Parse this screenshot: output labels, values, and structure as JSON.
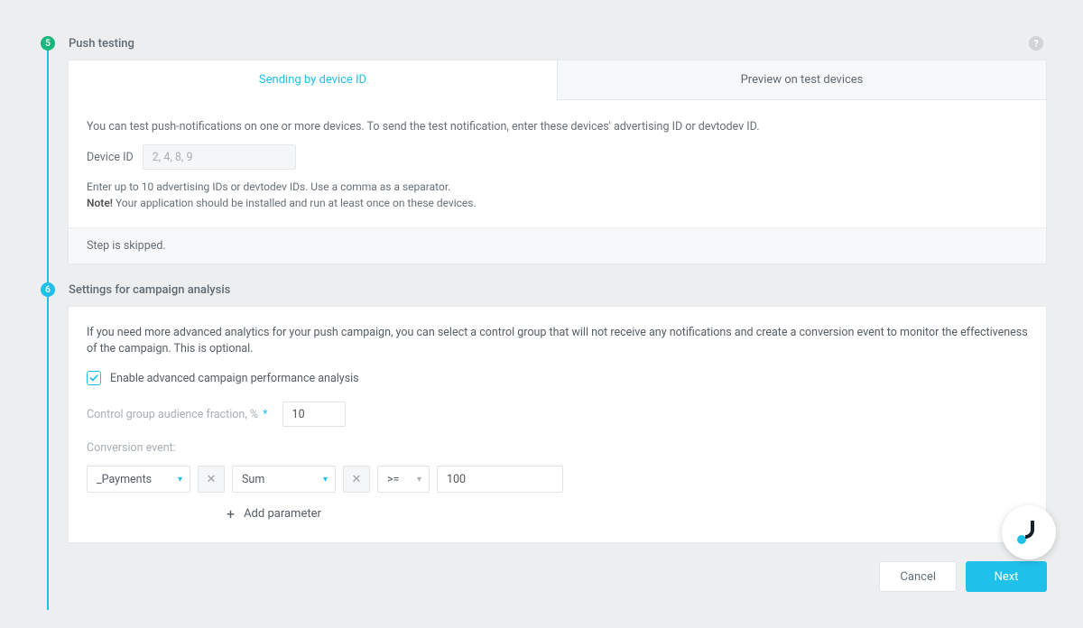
{
  "step5": {
    "number": "5",
    "title": "Push testing",
    "tabs": {
      "sending": "Sending by device ID",
      "preview": "Preview on test devices"
    },
    "intro": "You can test push-notifications on one or more devices. To send the test notification, enter these devices' advertising ID or devtodev ID.",
    "device_id_label": "Device ID",
    "device_id_placeholder": "2, 4, 8, 9",
    "hint_line1": "Enter up to 10 advertising IDs or devtodev IDs. Use a comma as a separator.",
    "hint_note_label": "Note!",
    "hint_line2": " Your application should be installed and run at least once on these devices.",
    "skip_text": "Step is skipped."
  },
  "step6": {
    "number": "6",
    "title": "Settings for campaign analysis",
    "desc": "If you need more advanced analytics for your push campaign, you can select a control group that will not receive any notifications and create a conversion event to monitor the effectiveness of the campaign. This is optional.",
    "checkbox_label": "Enable advanced campaign performance analysis",
    "control_group_label": "Control group audience fraction, %",
    "control_group_value": "10",
    "conversion_label": "Conversion event:",
    "event_name": "_Payments",
    "agg": "Sum",
    "op": ">=",
    "value": "100",
    "add_parameter": "Add parameter"
  },
  "footer": {
    "cancel": "Cancel",
    "next": "Next"
  },
  "help_icon": "?"
}
